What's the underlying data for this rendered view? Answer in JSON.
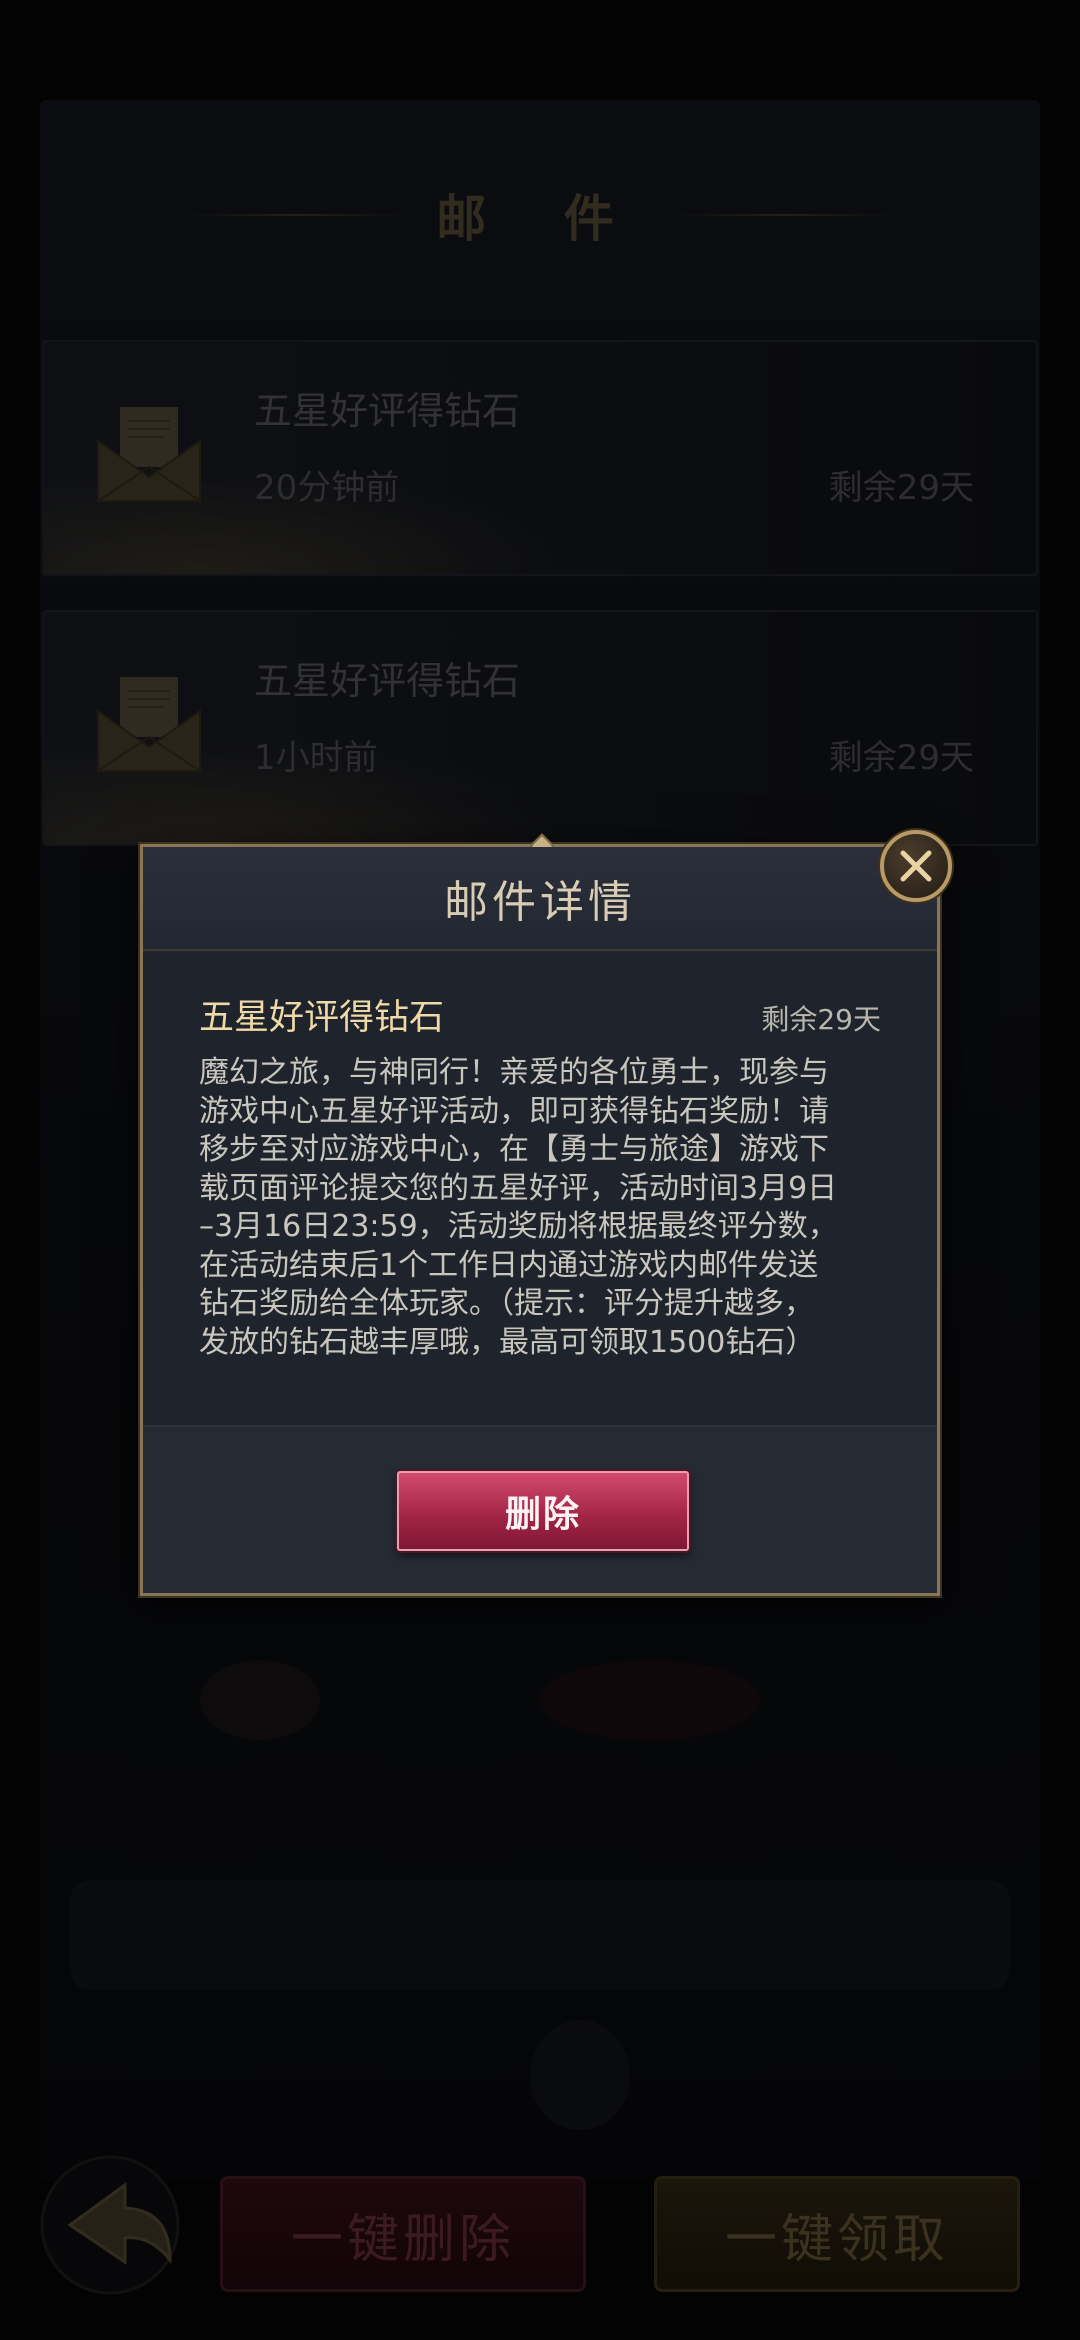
{
  "mail": {
    "title": "邮 件",
    "items": [
      {
        "title": "五星好评得钻石",
        "time": "20分钟前",
        "remain": "剩余29天"
      },
      {
        "title": "五星好评得钻石",
        "time": "1小时前",
        "remain": "剩余29天"
      }
    ]
  },
  "bottom": {
    "delete_all_label": "一键删除",
    "claim_all_label": "一键领取"
  },
  "modal": {
    "title": "邮件详情",
    "mail_title": "五星好评得钻石",
    "remain": "剩余29天",
    "content": "魔幻之旅，与神同行！亲爱的各位勇士，现参与\n游戏中心五星好评活动，即可获得钻石奖励！请\n移步至对应游戏中心，在【勇士与旅途】游戏下\n载页面评论提交您的五星好评，活动时间3月9日\n–3月16日23:59，活动奖励将根据最终评分数，\n在活动结束后1个工作日内通过游戏内邮件发送\n钻石奖励给全体玩家。（提示：评分提升越多，\n发放的钻石越丰厚哦，最高可领取1500钻石）",
    "delete_label": "删除"
  },
  "icons": {
    "close": "close-icon",
    "back": "back-arrow-icon",
    "mail": "envelope-icon"
  },
  "colors": {
    "accent_gold": "#c9b184",
    "delete_red": "#a52647",
    "detail_title": "#efd9a8"
  }
}
